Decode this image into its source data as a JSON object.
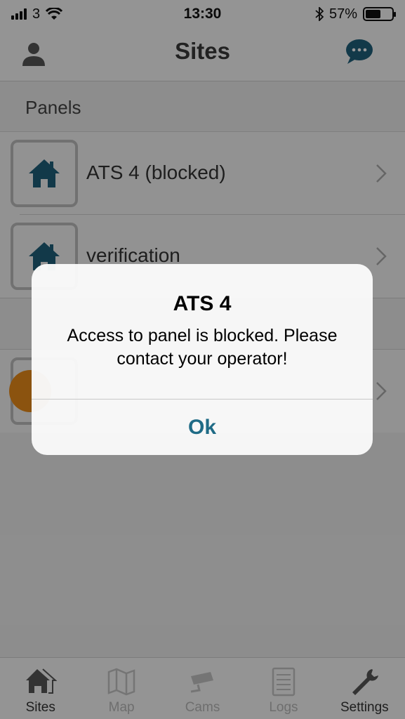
{
  "status_bar": {
    "carrier": "3",
    "time": "13:30",
    "battery_percent": "57%",
    "battery_level": 0.57,
    "icons": [
      "signal-bars-icon",
      "wifi-icon",
      "bluetooth-icon",
      "battery-icon"
    ]
  },
  "nav": {
    "title": "Sites",
    "left_icon": "user-icon",
    "right_icon": "chat-bubble-icon"
  },
  "list": {
    "section_header": "Panels",
    "rows": [
      {
        "label": "ATS 4 (blocked)",
        "icon": "house-icon"
      },
      {
        "label": "verification",
        "icon": "house-icon"
      },
      {
        "label": "",
        "icon": "orange-circle-icon"
      }
    ]
  },
  "tabbar": {
    "tabs": [
      {
        "label": "Sites",
        "icon": "house-icon",
        "active": true
      },
      {
        "label": "Map",
        "icon": "map-icon",
        "active": false
      },
      {
        "label": "Cams",
        "icon": "camera-icon",
        "active": false
      },
      {
        "label": "Logs",
        "icon": "logs-icon",
        "active": false
      },
      {
        "label": "Settings",
        "icon": "wrench-icon",
        "active": true
      }
    ]
  },
  "alert": {
    "title": "ATS 4",
    "message": "Access to panel is blocked. Please contact your operator!",
    "button_label": "Ok"
  },
  "colors": {
    "accent": "#1f5f7a",
    "orange": "#e88a1a",
    "alert_button": "#1f6b86"
  }
}
